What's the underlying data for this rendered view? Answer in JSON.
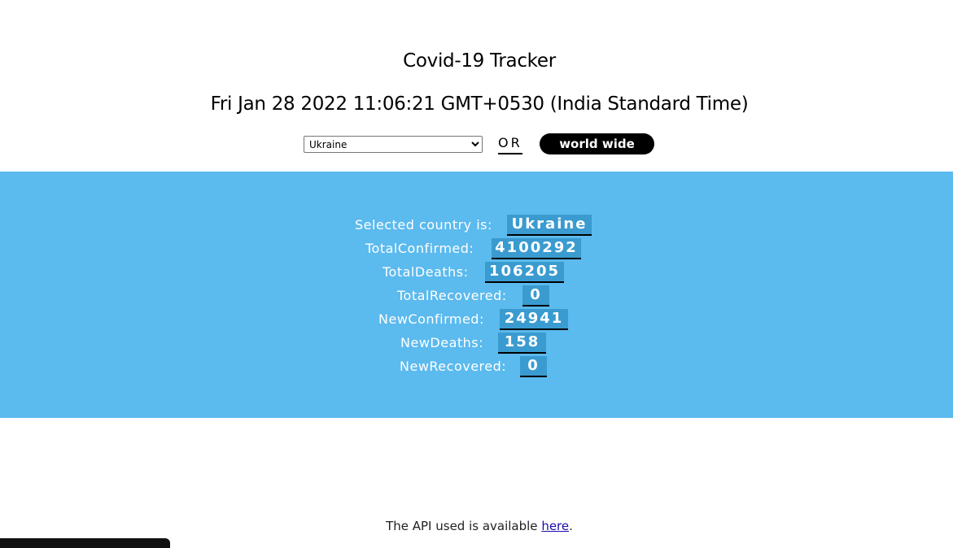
{
  "header": {
    "title": "Covid-19 Tracker",
    "datetime": "Fri Jan 28 2022 11:06:21 GMT+0530 (India Standard Time)"
  },
  "controls": {
    "country_selected": "Ukraine",
    "or_label": "OR",
    "world_button_label": "world wide"
  },
  "stats": {
    "selected_country_label": "Selected country is:",
    "selected_country_value": "Ukraine",
    "total_confirmed_label": "TotalConfirmed:",
    "total_confirmed_value": "4100292",
    "total_deaths_label": "TotalDeaths:",
    "total_deaths_value": "106205",
    "total_recovered_label": "TotalRecovered:",
    "total_recovered_value": "0",
    "new_confirmed_label": "NewConfirmed:",
    "new_confirmed_value": "24941",
    "new_deaths_label": "NewDeaths:",
    "new_deaths_value": "158",
    "new_recovered_label": "NewRecovered:",
    "new_recovered_value": "0"
  },
  "footer": {
    "text_before": "The API used is available ",
    "link_text": "here",
    "text_after": "."
  },
  "colors": {
    "band": "#5bbaee",
    "value_bg": "#3a9bd0",
    "button": "#000000"
  }
}
